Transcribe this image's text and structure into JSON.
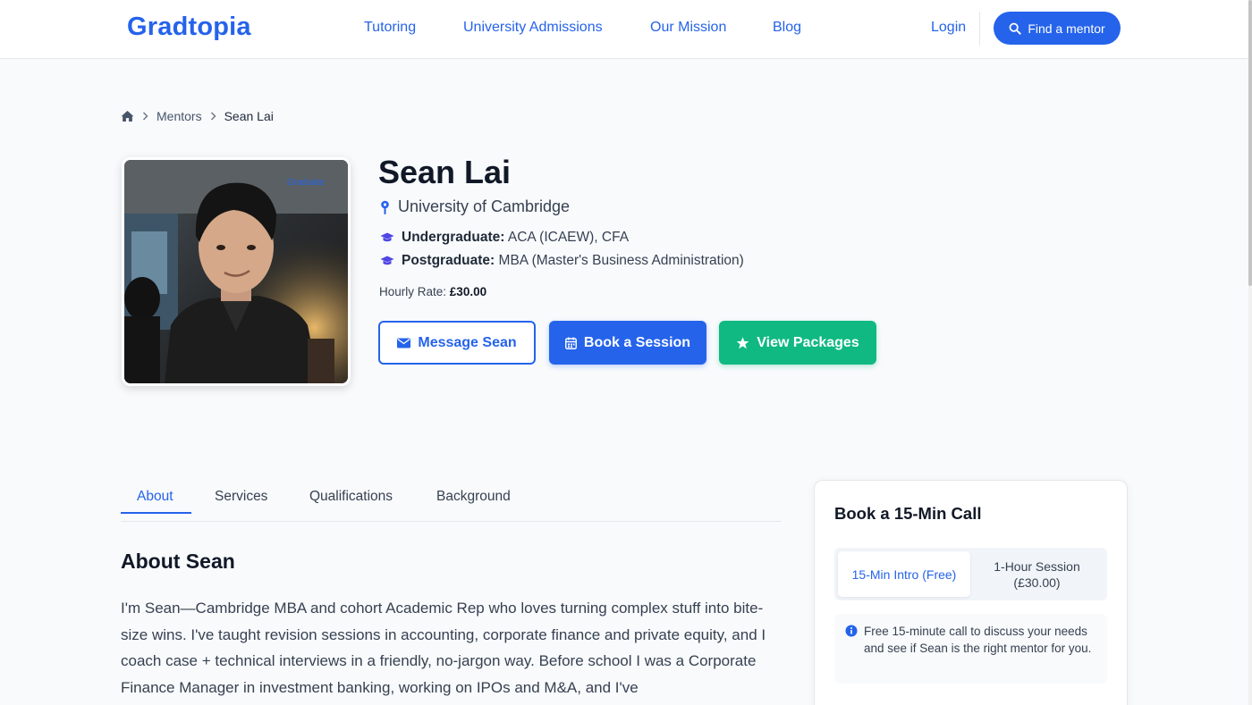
{
  "header": {
    "logo": "Gradtopia",
    "nav": [
      "Tutoring",
      "University Admissions",
      "Our Mission",
      "Blog"
    ],
    "login": "Login",
    "find_mentor": "Find a mentor"
  },
  "breadcrumb": {
    "items": [
      "Mentors",
      "Sean Lai"
    ]
  },
  "profile": {
    "photo_badge": "Graduate",
    "name": "Sean Lai",
    "university": "University of Cambridge",
    "undergrad_label": "Undergraduate:",
    "undergrad_value": "ACA (ICAEW), CFA",
    "postgrad_label": "Postgraduate:",
    "postgrad_value": "MBA (Master's Business Administration)",
    "rate_label": "Hourly Rate:",
    "rate_value": "£30.00",
    "buttons": {
      "message": "Message Sean",
      "book": "Book a Session",
      "packages": "View Packages"
    }
  },
  "tabs": [
    "About",
    "Services",
    "Qualifications",
    "Background"
  ],
  "about": {
    "title": "About Sean",
    "text": "I'm Sean—Cambridge MBA and cohort Academic Rep who loves turning complex stuff into bite-size wins. I've taught revision sessions in accounting, corporate finance and private equity, and I coach case + technical interviews in a friendly, no-jargon way. Before school I was a Corporate Finance Manager in investment banking, working on IPOs and M&A, and I've"
  },
  "booking": {
    "title": "Book a 15-Min Call",
    "option_intro": "15-Min Intro (Free)",
    "option_hour": "1-Hour Session (£30.00)",
    "info": "Free 15-minute call to discuss your needs and see if Sean is the right mentor for you."
  },
  "colors": {
    "brand": "#2563eb",
    "success": "#10b981"
  }
}
